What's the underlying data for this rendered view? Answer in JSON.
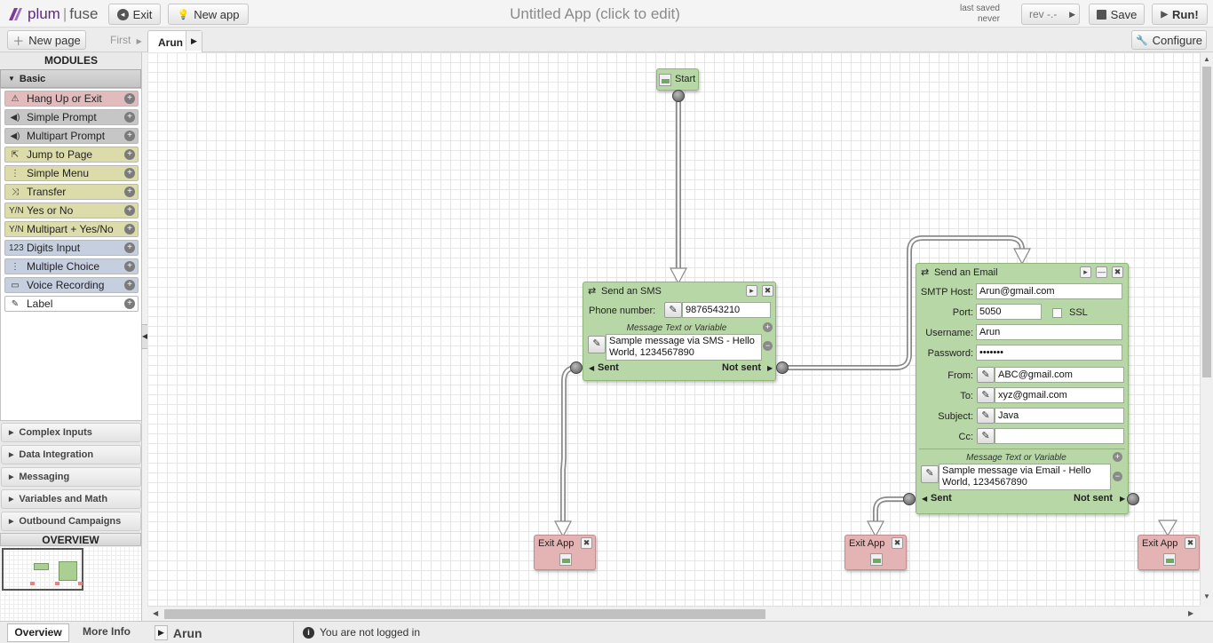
{
  "app": {
    "logo_left": "plum",
    "logo_right": "fuse",
    "title": "Untitled App (click to edit)"
  },
  "toolbar": {
    "exit": "Exit",
    "new_app": "New app",
    "last_saved_label": "last saved",
    "last_saved_value": "never",
    "rev": "rev -.-",
    "save": "Save",
    "run": "Run!"
  },
  "pages": {
    "new_page": "New page",
    "first": "First",
    "tab": "Arun",
    "configure": "Configure"
  },
  "sidebar": {
    "modules_title": "MODULES",
    "basic_label": "Basic",
    "modules": [
      {
        "label": "Hang Up or Exit",
        "icon": "warning-icon",
        "color": "#e2bcbc"
      },
      {
        "label": "Simple Prompt",
        "icon": "speaker-icon",
        "color": "#c6c6c6"
      },
      {
        "label": "Multipart Prompt",
        "icon": "speaker-icon",
        "color": "#c6c6c6"
      },
      {
        "label": "Jump to Page",
        "icon": "external-link-icon",
        "color": "#dcdcaa"
      },
      {
        "label": "Simple Menu",
        "icon": "menu-tree-icon",
        "color": "#dcdcaa"
      },
      {
        "label": "Transfer",
        "icon": "shuffle-icon",
        "color": "#dcdcaa"
      },
      {
        "label": "Yes or No",
        "icon": "yes-no-icon",
        "color": "#dcdcaa"
      },
      {
        "label": "Multipart + Yes/No",
        "icon": "yes-no-icon",
        "color": "#dcdcaa"
      },
      {
        "label": "Digits Input",
        "icon": "digits-icon",
        "color": "#c5cfdf"
      },
      {
        "label": "Multiple Choice",
        "icon": "menu-tree-icon",
        "color": "#c5cfdf"
      },
      {
        "label": "Voice Recording",
        "icon": "tape-icon",
        "color": "#c5cfdf"
      },
      {
        "label": "Label",
        "icon": "pin-icon",
        "color": "#ffffff"
      }
    ],
    "categories": [
      "Complex Inputs",
      "Data Integration",
      "Messaging",
      "Variables and Math",
      "Outbound Campaigns"
    ],
    "overview_title": "OVERVIEW"
  },
  "canvas": {
    "start": {
      "title": "Start"
    },
    "sms": {
      "title": "Send an SMS",
      "phone_label": "Phone number:",
      "phone_value": "9876543210",
      "msg_label": "Message Text or Variable",
      "msg_value": "Sample message via SMS - Hello World, 1234567890",
      "sent": "Sent",
      "not_sent": "Not sent"
    },
    "email": {
      "title": "Send an Email",
      "smtp_label": "SMTP Host:",
      "smtp_value": "Arun@gmail.com",
      "port_label": "Port:",
      "port_value": "5050",
      "ssl_label": "SSL",
      "username_label": "Username:",
      "username_value": "Arun",
      "password_label": "Password:",
      "password_value": "•••••••",
      "from_label": "From:",
      "from_value": "ABC@gmail.com",
      "to_label": "To:",
      "to_value": "xyz@gmail.com",
      "subject_label": "Subject:",
      "subject_value": "Java",
      "cc_label": "Cc:",
      "cc_value": "",
      "msg_label": "Message Text or Variable",
      "msg_value": "Sample message via Email - Hello World, 1234567890",
      "sent": "Sent",
      "not_sent": "Not sent"
    },
    "exits": [
      {
        "title": "Exit App"
      },
      {
        "title": "Exit App"
      },
      {
        "title": "Exit App"
      }
    ]
  },
  "bottom": {
    "overview_tab": "Overview",
    "more_info_tab": "More Info",
    "page_name": "Arun",
    "status": "You are not logged in"
  }
}
